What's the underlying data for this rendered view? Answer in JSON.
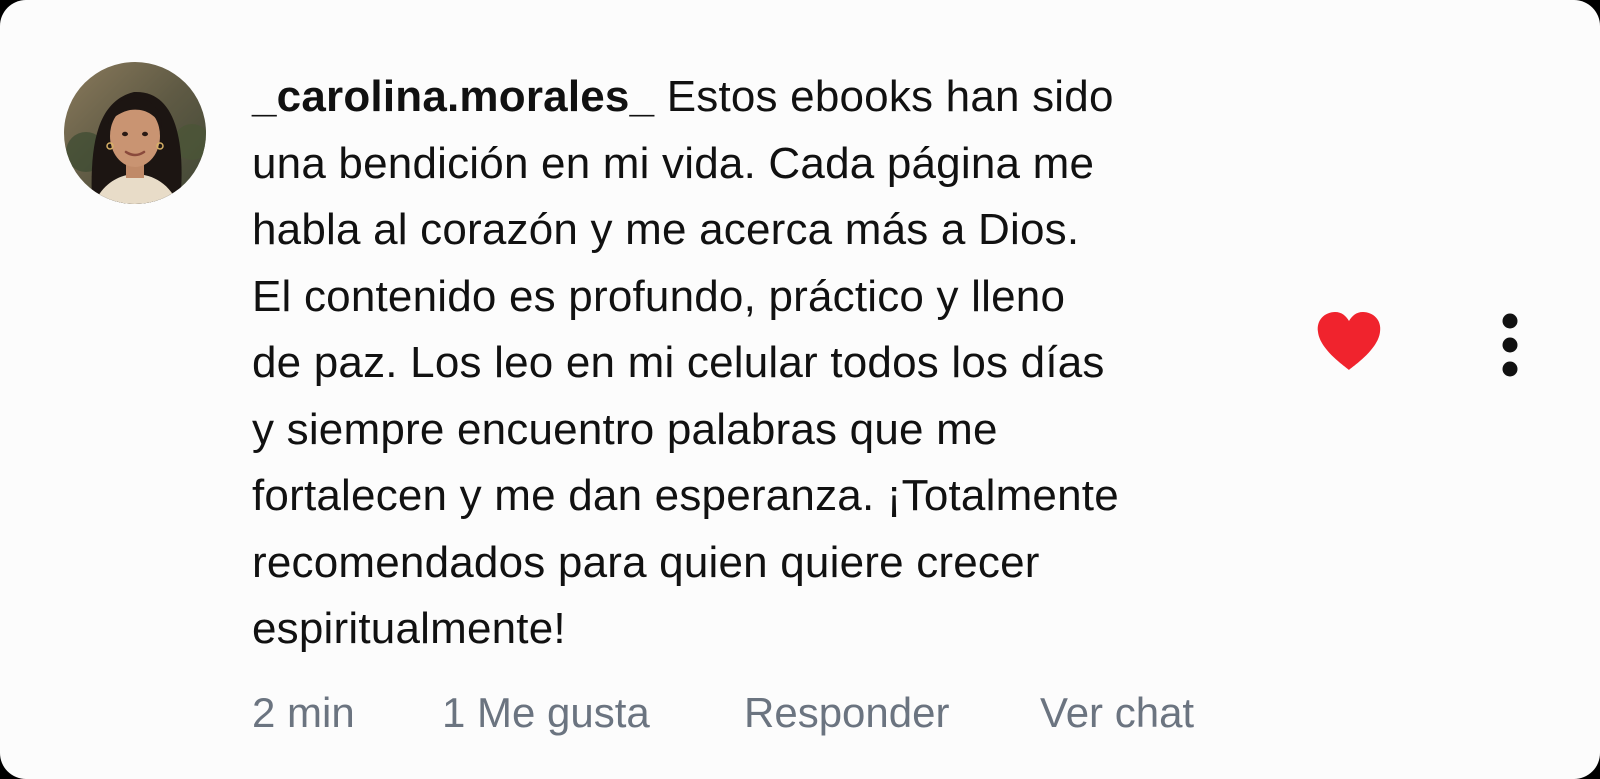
{
  "comment": {
    "username": "_carolina.morales_",
    "text_lines": [
      " Estos ebooks han sido",
      "una bendición en mi vida. Cada página me",
      "habla al corazón y me acerca más a Dios.",
      "El contenido es profundo, práctico y lleno",
      "de paz. Los leo en mi celular todos los días",
      "y siempre encuentro palabras que me",
      "fortalecen y me dan esperanza. ¡Totalmente",
      "recomendados para quien quiere crecer",
      "espiritualmente!"
    ],
    "liked": true,
    "heart_color": "#f0232d"
  },
  "actions": {
    "time": "2 min",
    "likes": "1 Me gusta",
    "reply": "Responder",
    "chat": "Ver chat"
  },
  "icons": {
    "avatar": "profile-photo",
    "like": "heart-icon",
    "menu": "more-vertical-icon"
  }
}
